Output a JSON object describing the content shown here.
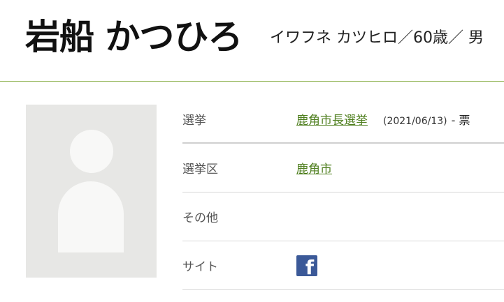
{
  "candidate": {
    "name": "岩船 かつひろ",
    "reading_age_gender": "イワフネ カツヒロ／60歳／ 男"
  },
  "info": {
    "election_label": "選挙",
    "election_value": "鹿角市長選挙",
    "election_date": "(2021/06/13)",
    "election_votes": "- 票",
    "district_label": "選挙区",
    "district_value": "鹿角市",
    "other_label": "その他",
    "site_label": "サイト"
  },
  "icons": {
    "photo": "person-silhouette-icon",
    "site": "facebook-icon",
    "facebook_glyph": "f"
  },
  "colors": {
    "link": "#4f7f1f",
    "header_rule": "#8bb04a",
    "facebook": "#3b5998"
  }
}
